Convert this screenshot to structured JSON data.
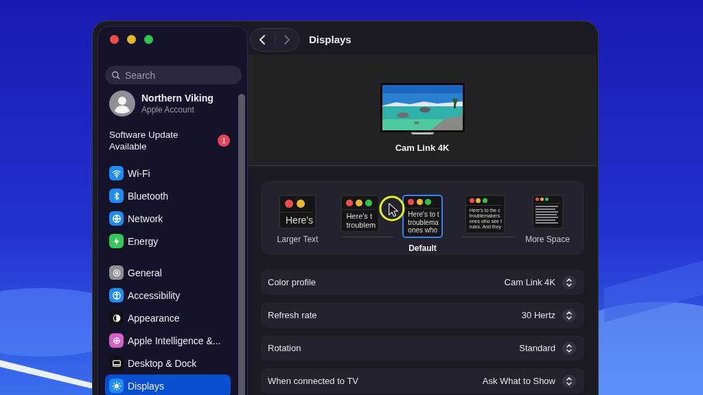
{
  "window": {
    "title": "Displays"
  },
  "nav": [
    {
      "kind": "back",
      "disabled": false
    },
    {
      "kind": "forward",
      "disabled": true
    }
  ],
  "sidebar": {
    "search": {
      "placeholder": "Search"
    },
    "account": {
      "name": "Northern Viking",
      "subtitle": "Apple Account"
    },
    "update": {
      "label": "Software Update Available",
      "badge": "1"
    },
    "groups": [
      {
        "items": [
          {
            "label": "Wi-Fi",
            "color": "#1e8cf5",
            "selected": false
          },
          {
            "label": "Bluetooth",
            "color": "#1e8cf5",
            "selected": false
          },
          {
            "label": "Network",
            "color": "#1e8cf5",
            "selected": false
          },
          {
            "label": "Energy",
            "color": "#34c759",
            "selected": false
          }
        ]
      },
      {
        "items": [
          {
            "label": "General",
            "color": "#8e8e93",
            "selected": false
          },
          {
            "label": "Accessibility",
            "color": "#1e8cf5",
            "selected": false
          },
          {
            "label": "Appearance",
            "color": "#111111",
            "selected": false
          },
          {
            "label": "Apple Intelligence &...",
            "color": "#d660c8",
            "selected": false
          },
          {
            "label": "Desktop & Dock",
            "color": "#111111",
            "selected": false
          },
          {
            "label": "Displays",
            "color": "#1e8cf5",
            "selected": true
          }
        ]
      }
    ]
  },
  "display": {
    "name": "Cam Link 4K"
  },
  "resolution_options": [
    {
      "label": "Larger Text",
      "preview_lines": [
        "Here's"
      ],
      "selected": false
    },
    {
      "preview_lines": [
        "Here's t",
        "troublem"
      ],
      "selected": false
    },
    {
      "label": "Default",
      "preview_lines": [
        "Here's to t",
        "troublema",
        "ones who"
      ],
      "selected": true
    },
    {
      "preview_lines": [
        "Here's to the c",
        "troublemakers.",
        "ones who see t",
        "rules. And they"
      ],
      "selected": false
    },
    {
      "label": "More Space",
      "selected": false
    }
  ],
  "settings": [
    {
      "label": "Color profile",
      "value": "Cam Link 4K"
    },
    {
      "label": "Refresh rate",
      "value": "30 Hertz"
    },
    {
      "label": "Rotation",
      "value": "Standard"
    },
    {
      "label": "When connected to TV",
      "value": "Ask What to Show"
    }
  ]
}
